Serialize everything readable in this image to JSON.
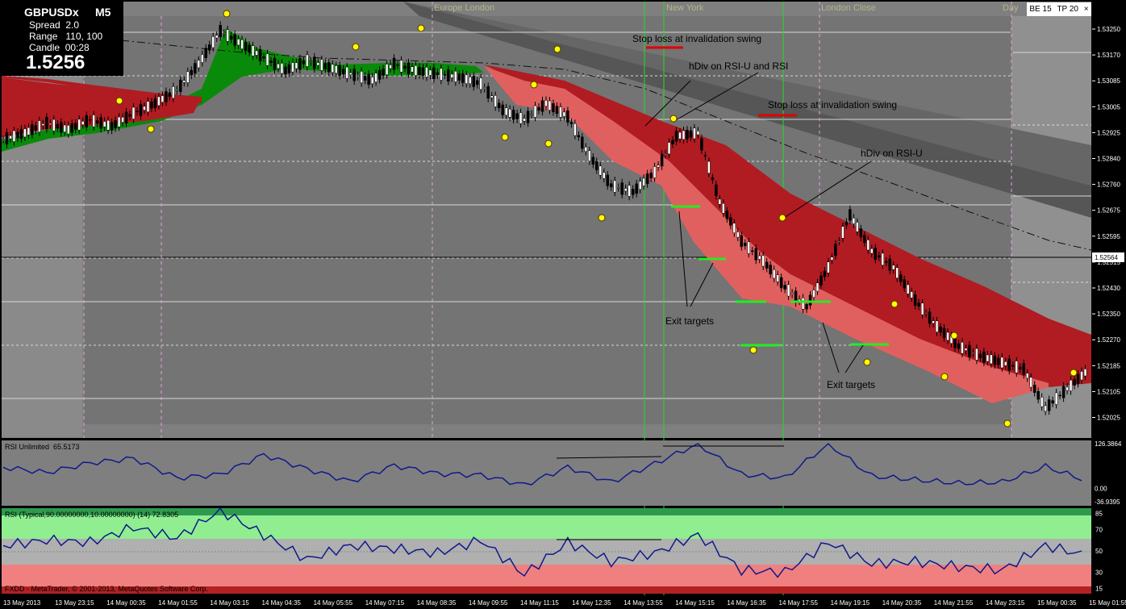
{
  "instrument": {
    "symbol": "GBPUSDx",
    "timeframe": "M5",
    "spread_label": "Spread",
    "spread_value": "2.0",
    "range_label": "Range",
    "range_value": "110, 100",
    "candle_label": "Candle",
    "candle_value": "00:28",
    "bid": "1.5256"
  },
  "tag_box": {
    "be": "BE 15",
    "tp": "TP 20",
    "close_glyph": "×"
  },
  "sessions": {
    "europe": "Europe   London",
    "newyork": "New York",
    "london_close": "London Close",
    "day": "Day"
  },
  "annotations": {
    "stop_loss_1": "Stop loss at invalidation swing",
    "stop_loss_2": "Stop loss at invalidation swing",
    "hdiv_1": "hDiv on RSI-U and RSI",
    "hdiv_2": "hDiv on RSI-U",
    "exit_targets_1": "Exit targets",
    "exit_targets_2": "Exit targets"
  },
  "current_price_label": "1.52564",
  "copyright": "FXDD - MetaTrader, © 2001-2013, MetaQuotes Software Corp.",
  "colors": {
    "panel_bg": "#7f7f7f",
    "down_band": "#b01c22",
    "down_band_light": "#e06060",
    "up_band": "#0a8a0a",
    "rsi_line": "#101a8a",
    "session_line": "#22dd22",
    "target_line": "#22ee22"
  },
  "chart_data": [
    {
      "type": "line",
      "title": "GBPUSDx M5",
      "yticks": [
        "1.53250",
        "1.53170",
        "1.53085",
        "1.53005",
        "1.52925",
        "1.52840",
        "1.52760",
        "1.52675",
        "1.52595",
        "1.52515",
        "1.52430",
        "1.52350",
        "1.52270",
        "1.52185",
        "1.52105",
        "1.52025"
      ],
      "xticks": [
        "13 May 2013",
        "13 May 23:15",
        "14 May 00:35",
        "14 May 01:55",
        "14 May 03:15",
        "14 May 04:35",
        "14 May 05:55",
        "14 May 07:15",
        "14 May 08:35",
        "14 May 09:55",
        "14 May 11:15",
        "14 May 12:35",
        "14 May 13:55",
        "14 May 15:15",
        "14 May 16:35",
        "14 May 17:55",
        "14 May 19:15",
        "14 May 20:35",
        "14 May 21:55",
        "14 May 23:15",
        "15 May 00:35",
        "15 May 01:55"
      ],
      "ylim": [
        1.5198,
        1.5331
      ],
      "x": [
        0,
        6,
        12,
        18,
        24,
        30,
        36,
        42,
        48,
        54,
        60,
        66,
        72,
        78,
        84,
        90,
        96,
        102,
        108,
        114,
        120,
        126,
        132,
        138,
        144,
        150,
        156,
        162,
        168,
        174,
        180,
        186,
        192,
        198,
        204,
        210,
        216,
        222,
        228,
        234,
        240,
        246,
        252,
        258,
        264,
        270,
        276,
        282,
        288,
        294,
        300
      ],
      "series": [
        {
          "values": [
            1.5289,
            1.5291,
            1.5294,
            1.5292,
            1.5295,
            1.5293,
            1.5297,
            1.53,
            1.5304,
            1.5312,
            1.5322,
            1.5318,
            1.5314,
            1.531,
            1.5313,
            1.5311,
            1.5309,
            1.5307,
            1.5312,
            1.531,
            1.5309,
            1.5308,
            1.5306,
            1.5298,
            1.5295,
            1.53,
            1.5296,
            1.5284,
            1.5275,
            1.5273,
            1.5279,
            1.529,
            1.5291,
            1.527,
            1.5258,
            1.5252,
            1.5244,
            1.5238,
            1.525,
            1.5266,
            1.5255,
            1.525,
            1.524,
            1.5232,
            1.5226,
            1.5223,
            1.5221,
            1.5219,
            1.5207,
            1.5213,
            1.5219
          ]
        }
      ],
      "current_price": 1.52564
    },
    {
      "type": "line",
      "title": "RSI Unlimited",
      "value_label": "65.5173",
      "yticks": [
        "126.3864",
        "0.00",
        "-36.9395"
      ],
      "ylim": [
        -36.9395,
        126.3864
      ],
      "x": [
        0,
        12,
        24,
        36,
        48,
        60,
        72,
        84,
        96,
        108,
        120,
        132,
        144,
        156,
        168,
        180,
        192,
        204,
        216,
        228,
        240,
        252,
        264,
        276,
        288,
        300
      ],
      "values": [
        60,
        45,
        72,
        85,
        30,
        40,
        95,
        55,
        20,
        65,
        42,
        38,
        10,
        60,
        18,
        70,
        126,
        40,
        30,
        126,
        35,
        25,
        15,
        18,
        62,
        20
      ]
    },
    {
      "type": "line",
      "title": "RSI (Typical,90.00000000,10.00000000) (14)",
      "value_label": "72.8305",
      "yticks": [
        "85",
        "70",
        "50",
        "30",
        "15"
      ],
      "ylim": [
        10,
        90
      ],
      "x": [
        0,
        12,
        24,
        36,
        48,
        60,
        72,
        84,
        96,
        108,
        120,
        132,
        144,
        156,
        168,
        180,
        192,
        204,
        216,
        228,
        240,
        252,
        264,
        276,
        288,
        300
      ],
      "values": [
        55,
        60,
        58,
        72,
        62,
        88,
        65,
        42,
        55,
        52,
        48,
        60,
        28,
        58,
        40,
        48,
        65,
        32,
        30,
        58,
        38,
        40,
        35,
        32,
        55,
        45
      ]
    }
  ]
}
